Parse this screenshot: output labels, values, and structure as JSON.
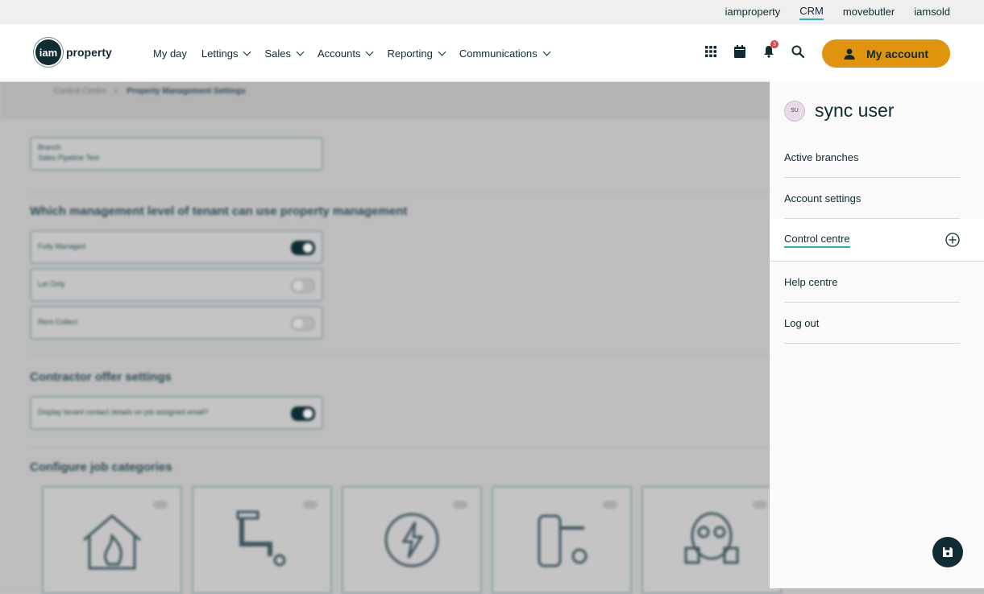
{
  "top_links": [
    "iamproperty",
    "CRM",
    "movebutler",
    "iamsold"
  ],
  "active_top_link": "CRM",
  "logo": {
    "mark": "iam",
    "text": "property"
  },
  "nav": [
    "My day",
    "Lettings",
    "Sales",
    "Accounts",
    "Reporting",
    "Communications"
  ],
  "notification_count": "3",
  "account_button": "My account",
  "background": {
    "breadcrumb": [
      "Control Centre",
      "Property Management Settings"
    ],
    "branch_field": {
      "label": "Branch",
      "value": "Sales Pipeline Test"
    },
    "management_title": "Which management level of tenant can use property management",
    "management_options": [
      {
        "label": "Fully Managed",
        "on": true
      },
      {
        "label": "Let Only",
        "on": false
      },
      {
        "label": "Rent Collect",
        "on": false
      }
    ],
    "contractor_title": "Contractor offer settings",
    "contractor_option": {
      "label": "Display tenant contact details on job assigned email?",
      "on": true
    },
    "job_categories_title": "Configure job categories",
    "job_category_icons": [
      "fire-house-icon",
      "plumbing-icon",
      "electric-icon",
      "door-lock-icon",
      "gas-mask-icon"
    ]
  },
  "panel": {
    "avatar_initials": "SU",
    "user_name": "sync user",
    "menu": [
      "Active branches",
      "Account settings",
      "Control centre",
      "Help centre",
      "Log out"
    ]
  },
  "colors": {
    "accent": "#e0940e",
    "primary": "#0f2b33",
    "link_underline": "#1fb2c6"
  }
}
